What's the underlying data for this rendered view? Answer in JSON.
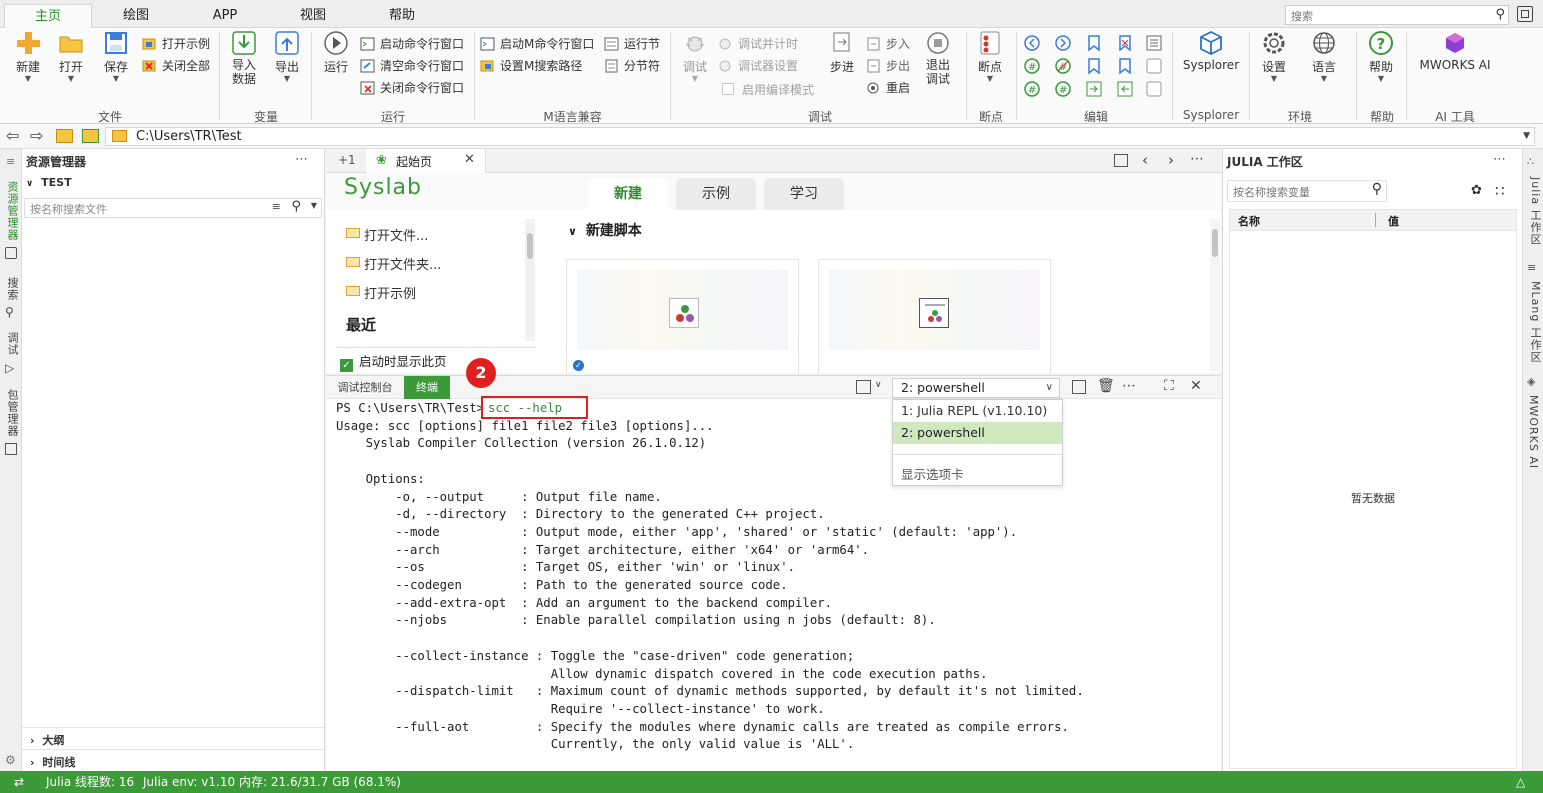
{
  "menu": {
    "tabs": [
      "主页",
      "绘图",
      "APP",
      "视图",
      "帮助"
    ],
    "active": "主页",
    "search_placeholder": "搜索"
  },
  "ribbon": {
    "file": {
      "new": "新建",
      "open": "打开",
      "save": "保存",
      "open_example": "打开示例",
      "close_all": "关闭全部",
      "label": "文件"
    },
    "variable": {
      "import": "导入\n数据",
      "export": "导出",
      "label": "变量"
    },
    "run": {
      "run": "运行",
      "start_cmd": "启动命令行窗口",
      "clear_cmd": "清空命令行窗口",
      "close_cmd": "关闭命令行窗口",
      "label": "运行"
    },
    "mlang": {
      "start_m_cmd": "启动M命令行窗口",
      "set_m_path": "设置M搜索路径",
      "run_section": "运行节",
      "section": "分节符",
      "label": "M语言兼容"
    },
    "debug": {
      "debug": "调试",
      "parallel_timer": "调试并计时",
      "debugger_settings": "调试器设置",
      "compile_mode": "启用编译模式",
      "step_in_label": "步进",
      "step_into": "步入",
      "step_out": "步出",
      "restart": "重启",
      "exit_debug": "退出\n调试",
      "label": "调试"
    },
    "breakpoint": {
      "bp": "断点",
      "label": "断点"
    },
    "edit": {
      "label": "编辑"
    },
    "sysplorer": {
      "btn": "Sysplorer",
      "label": "Sysplorer"
    },
    "env": {
      "settings": "设置",
      "language": "语言",
      "label": "环境"
    },
    "help": {
      "help": "帮助",
      "label": "帮助"
    },
    "ai": {
      "mworks_ai": "MWORKS AI",
      "label": "AI 工具"
    }
  },
  "address": {
    "path": "C:\\Users\\TR\\Test"
  },
  "left_strip": {
    "explorer": "资源管理器",
    "search": "搜索",
    "debug": "调试",
    "pkg": "包管理器"
  },
  "explorer": {
    "title": "资源管理器",
    "root": "TEST",
    "search_placeholder": "按名称搜索文件",
    "outline": "大纲",
    "timeline": "时间线"
  },
  "editor_tabs": {
    "plus": "+1",
    "start_tab": "起始页"
  },
  "start_page": {
    "logo": "Syslab",
    "tabs": [
      "新建",
      "示例",
      "学习"
    ],
    "links": [
      "打开文件...",
      "打开文件夹...",
      "打开示例"
    ],
    "recent": "最近",
    "show_on_startup": "启动时显示此页",
    "new_script": "新建脚本"
  },
  "annotation": {
    "number": "2"
  },
  "terminal_bar": {
    "tabs": [
      "调试控制台",
      "终端"
    ],
    "active": "终端",
    "selected": "2: powershell"
  },
  "dropdown": {
    "options": [
      "1: Julia REPL (v1.10.10)",
      "2: powershell"
    ],
    "selected": "2: powershell",
    "footer": "显示选项卡"
  },
  "terminal": {
    "prompt": "PS C:\\Users\\TR\\Test>",
    "command": "scc --help",
    "lines": [
      "Usage: scc [options] file1 file2 file3 [options]...",
      "    Syslab Compiler Collection (version 26.1.0.12)",
      "",
      "    Options:",
      "        -o, --output     : Output file name.",
      "        -d, --directory  : Directory to the generated C++ project.",
      "        --mode           : Output mode, either 'app', 'shared' or 'static' (default: 'app').",
      "        --arch           : Target architecture, either 'x64' or 'arm64'.",
      "        --os             : Target OS, either 'win' or 'linux'.",
      "        --codegen        : Path to the generated source code.",
      "        --add-extra-opt  : Add an argument to the backend compiler.",
      "        --njobs          : Enable parallel compilation using n jobs (default: 8).",
      "",
      "        --collect-instance : Toggle the \"case-driven\" code generation;",
      "                             Allow dynamic dispatch covered in the code execution paths.",
      "        --dispatch-limit   : Maximum count of dynamic methods supported, by default it's not limited.",
      "                             Require '--collect-instance' to work.",
      "        --full-aot         : Specify the modules where dynamic calls are treated as compile errors.",
      "                             Currently, the only valid value is 'ALL'."
    ]
  },
  "julia_panel": {
    "title": "JULIA 工作区",
    "search_placeholder": "按名称搜索变量",
    "col_name": "名称",
    "col_value": "值",
    "empty": "暂无数据"
  },
  "right_strip": {
    "julia": "Julia 工作区",
    "mlang": "MLang 工作区",
    "ai": "MWORKS AI"
  },
  "status": {
    "threads": "Julia 线程数: 16",
    "env": "Julia env: v1.10",
    "memory": "内存: 21.6/31.7 GB (68.1%)"
  },
  "colors": {
    "accent": "#2e8b2e",
    "status_bar": "#3c9a38",
    "highlight_red": "#e02020",
    "dropdown_selected": "#cfe8c0"
  }
}
